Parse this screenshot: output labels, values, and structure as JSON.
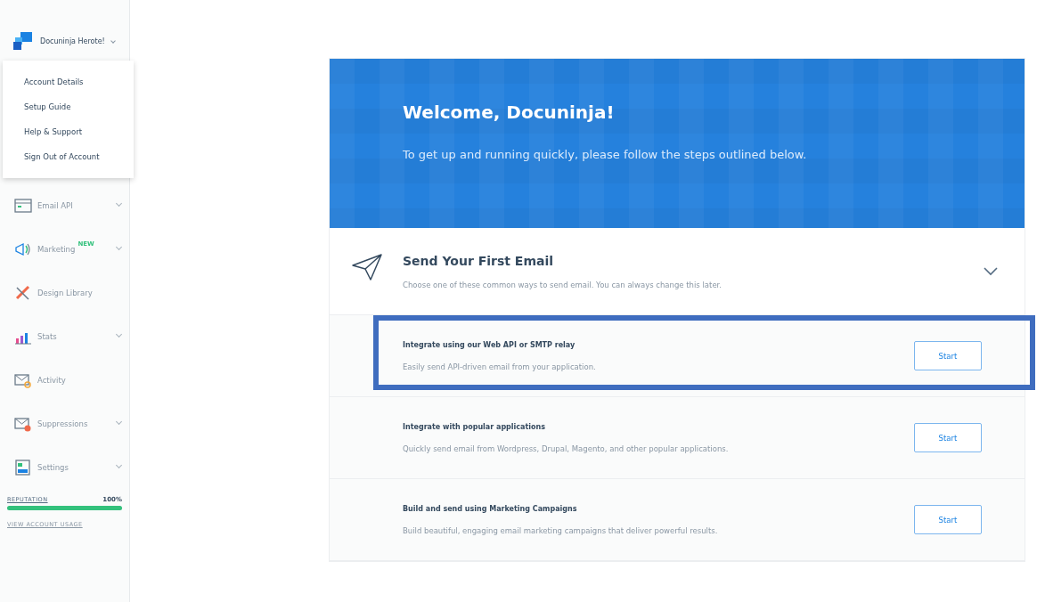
{
  "account": {
    "name": "Docuninja Herote!"
  },
  "account_menu": [
    "Account Details",
    "Setup Guide",
    "Help & Support",
    "Sign Out of Account"
  ],
  "nav": [
    {
      "label": "Email API",
      "kind": "email-api",
      "expandable": true
    },
    {
      "label": "Marketing",
      "kind": "marketing",
      "expandable": true,
      "badge": "NEW"
    },
    {
      "label": "Design Library",
      "kind": "design",
      "expandable": false
    },
    {
      "label": "Stats",
      "kind": "stats",
      "expandable": true
    },
    {
      "label": "Activity",
      "kind": "activity",
      "expandable": false
    },
    {
      "label": "Suppressions",
      "kind": "suppressions",
      "expandable": true
    },
    {
      "label": "Settings",
      "kind": "settings",
      "expandable": true
    }
  ],
  "reputation": {
    "label": "REPUTATION",
    "value": "100%",
    "level": 1.0
  },
  "usage_link": "VIEW ACCOUNT USAGE",
  "banner": {
    "title": "Welcome, Docuninja!",
    "subtitle": "To get up and running quickly, please follow the steps outlined below."
  },
  "step": {
    "title": "Send Your First Email",
    "description": "Choose one of these common ways to send email. You can always change this later.",
    "expanded": true
  },
  "options": [
    {
      "title": "Integrate using our Web API or SMTP relay",
      "description": "Easily send API-driven email from your application.",
      "button": "Start",
      "highlighted": true
    },
    {
      "title": "Integrate with popular applications",
      "description": "Quickly send email from Wordpress, Drupal, Magento, and other popular applications.",
      "button": "Start",
      "highlighted": false
    },
    {
      "title": "Build and send using Marketing Campaigns",
      "description": "Build beautiful, engaging email marketing campaigns that deliver powerful results.",
      "button": "Start",
      "highlighted": false
    }
  ]
}
